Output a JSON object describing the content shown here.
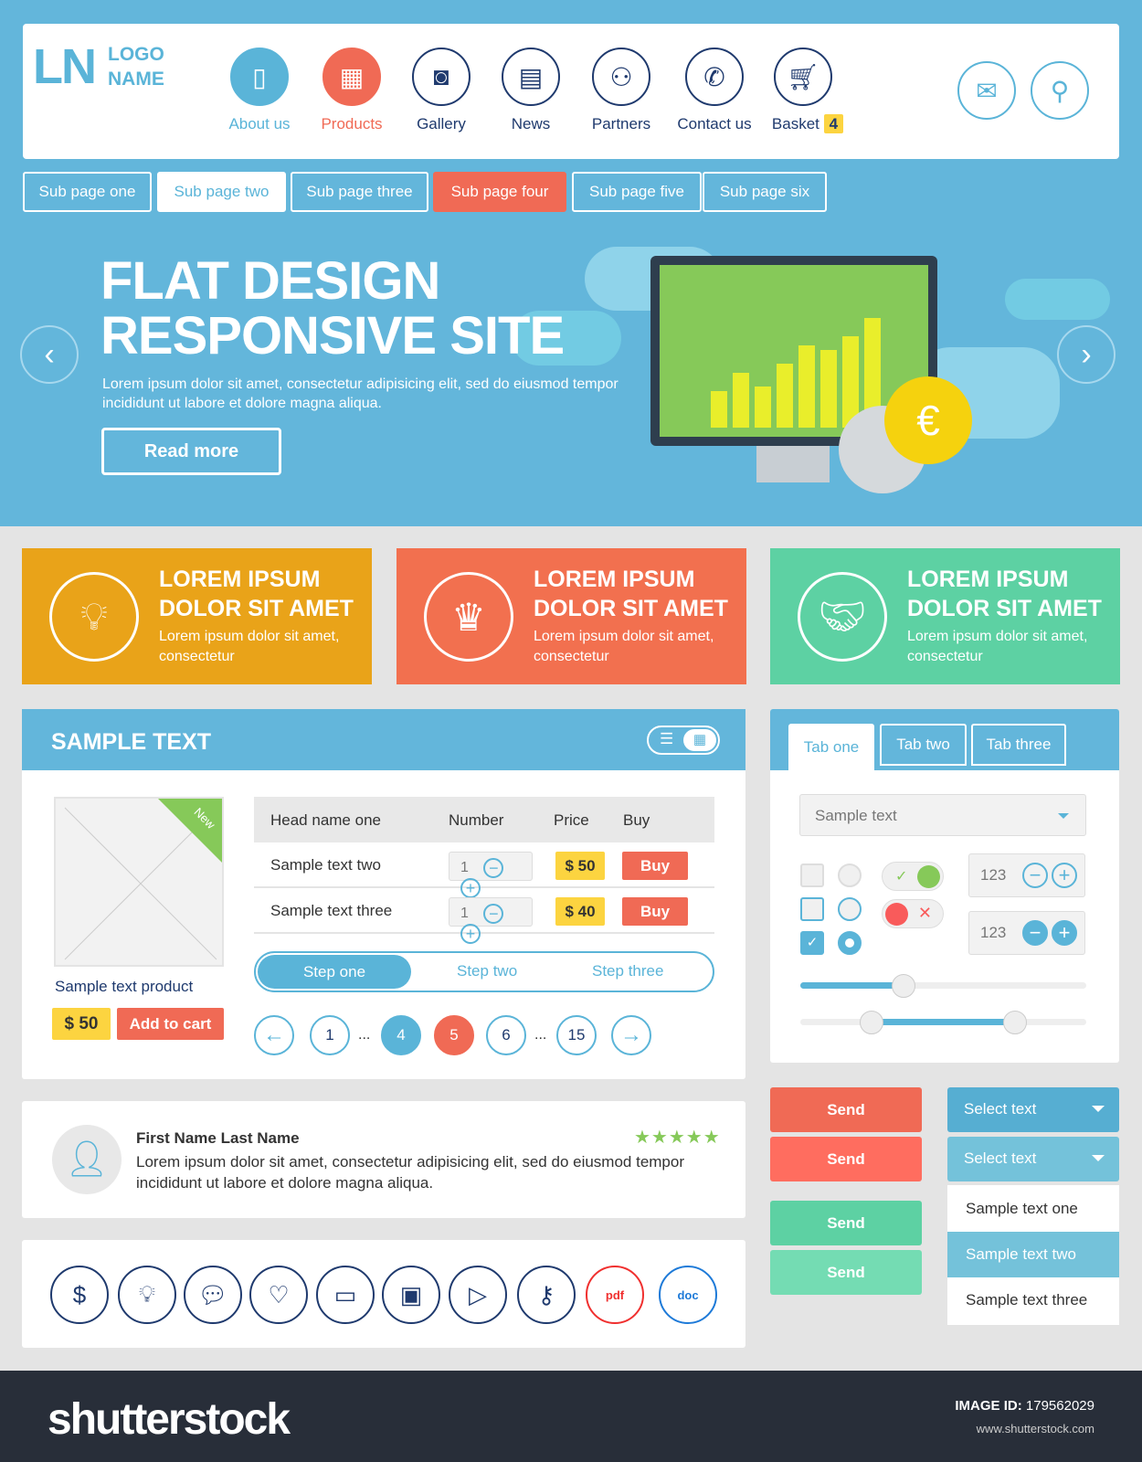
{
  "logo": {
    "mark": "LN",
    "line1": "LOGO",
    "line2": "NAME"
  },
  "nav": [
    {
      "label": "About us",
      "icon": "book-icon"
    },
    {
      "label": "Products",
      "icon": "grid-icon"
    },
    {
      "label": "Gallery",
      "icon": "camera-icon"
    },
    {
      "label": "News",
      "icon": "newspaper-icon"
    },
    {
      "label": "Partners",
      "icon": "users-icon"
    },
    {
      "label": "Contact us",
      "icon": "phone-icon"
    },
    {
      "label": "Basket",
      "icon": "cart-icon",
      "badge": "4"
    }
  ],
  "subnav": [
    "Sub page one",
    "Sub page two",
    "Sub page three",
    "Sub page four",
    "Sub page five",
    "Sub page six"
  ],
  "hero": {
    "title1": "FLAT DESIGN",
    "title2": "RESPONSIVE SITE",
    "text": "Lorem ipsum dolor sit amet, consectetur adipisicing elit, sed do eiusmod tempor incididunt ut labore et dolore magna aliqua.",
    "button": "Read more"
  },
  "features": [
    {
      "title1": "LOREM IPSUM",
      "title2": "DOLOR SIT AMET",
      "text": "Lorem ipsum dolor sit amet, consectetur",
      "color": "#e9a319",
      "icon": "lightbulb-icon"
    },
    {
      "title1": "LOREM IPSUM",
      "title2": "DOLOR SIT AMET",
      "text": "Lorem ipsum dolor sit amet, consectetur",
      "color": "#f2704f",
      "icon": "crown-icon"
    },
    {
      "title1": "LOREM IPSUM",
      "title2": "DOLOR SIT AMET",
      "text": "Lorem ipsum dolor sit amet, consectetur",
      "color": "#5dd1a3",
      "icon": "handshake-icon"
    }
  ],
  "sample": {
    "title": "SAMPLE TEXT",
    "product": {
      "ribbon": "New",
      "name": "Sample text product",
      "price": "$ 50",
      "add_to_cart": "Add to cart"
    },
    "table": {
      "headers": [
        "Head name one",
        "Number",
        "Price",
        "Buy"
      ],
      "rows": [
        {
          "name": "Sample text two",
          "qty": "1",
          "price": "$ 50",
          "buy": "Buy"
        },
        {
          "name": "Sample text three",
          "qty": "1",
          "price": "$ 40",
          "buy": "Buy"
        }
      ]
    },
    "steps": [
      "Step one",
      "Step two",
      "Step three"
    ],
    "pagination": {
      "pages": [
        "1",
        "4",
        "5",
        "6",
        "15"
      ],
      "ellipsis": "...",
      "current": "5"
    }
  },
  "tabs": {
    "items": [
      "Tab one",
      "Tab two",
      "Tab three"
    ],
    "dropdown": "Sample text",
    "number1": "123",
    "number2": "123",
    "slider1": 0.36,
    "slider2_range": [
      0.25,
      0.75
    ]
  },
  "review": {
    "name": "First Name Last Name",
    "rating": 5,
    "stars": "★★★★★",
    "text": "Lorem ipsum dolor sit amet, consectetur adipisicing elit, sed do eiusmod tempor incididunt ut labore et dolore magna aliqua."
  },
  "buttons": {
    "send": "Send"
  },
  "selects": {
    "select1": "Select text",
    "select2": "Select text",
    "options": [
      "Sample text one",
      "Sample text two",
      "Sample text three"
    ],
    "selected": "Sample text two"
  },
  "icons": [
    "dollar-coins-icon",
    "lightbulb-icon",
    "chat-icon",
    "heart-icon",
    "credit-card-icon",
    "wallet-icon",
    "play-icon",
    "key-icon",
    "pdf-icon",
    "doc-icon"
  ],
  "icon_labels": {
    "pdf": "pdf",
    "doc": "doc"
  },
  "footer": {
    "brand": "shutterstock",
    "image_id_label": "IMAGE ID:",
    "image_id": "179562029",
    "url": "www.shutterstock.com"
  }
}
